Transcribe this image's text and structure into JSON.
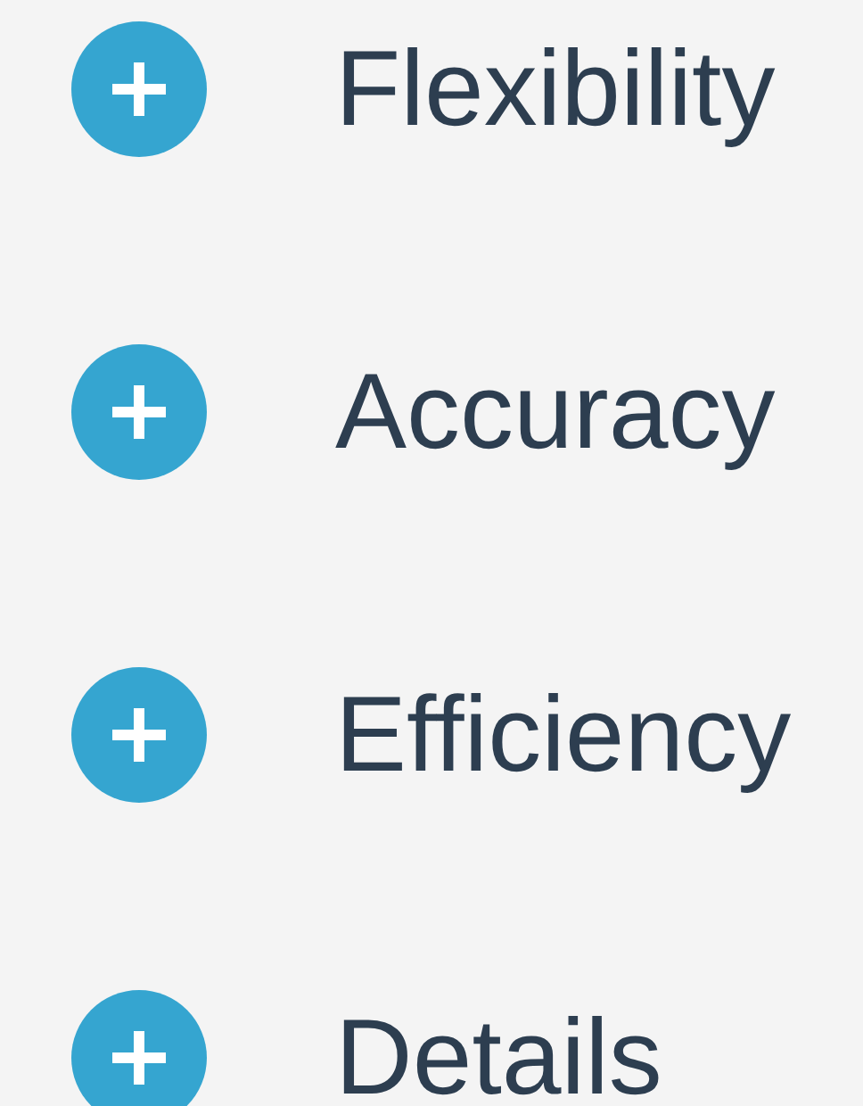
{
  "items": [
    {
      "label": "Flexibility",
      "expanded": false
    },
    {
      "label": "Accuracy",
      "expanded": false
    },
    {
      "label": "Efficiency",
      "expanded": false
    },
    {
      "label": "Details",
      "expanded": false
    }
  ]
}
